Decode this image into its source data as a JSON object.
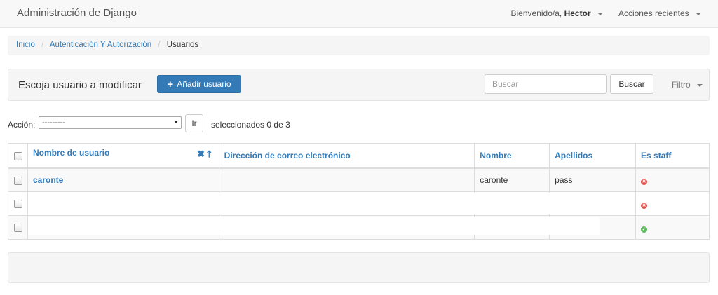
{
  "navbar": {
    "brand": "Administración de Django",
    "welcome_prefix": "Bienvenido/a,",
    "username": "Hector",
    "recent_actions": "Acciones recientes"
  },
  "breadcrumb": {
    "home": "Inicio",
    "section": "Autenticación Y Autorización",
    "current": "Usuarios"
  },
  "toolbar": {
    "title": "Escoja usuario a modificar",
    "add_label": "Añadir usuario",
    "search_placeholder": "Buscar",
    "search_button": "Buscar",
    "filter_label": "Filtro"
  },
  "actions": {
    "label": "Acción:",
    "selected_option": "---------",
    "go_label": "Ir",
    "selection_count": "seleccionados 0 de 3"
  },
  "table": {
    "columns": [
      "Nombre de usuario",
      "Dirección de correo electrónico",
      "Nombre",
      "Apellidos",
      "Es staff"
    ],
    "rows": [
      {
        "username": "caronte",
        "email": "",
        "first_name": "caronte",
        "last_name": "pass",
        "is_staff": "no"
      },
      {
        "username": "",
        "email": "",
        "first_name": "",
        "last_name": "",
        "is_staff": "no"
      },
      {
        "username": "",
        "email": "",
        "first_name": "",
        "last_name": "",
        "is_staff": "yes"
      }
    ]
  },
  "colors": {
    "primary": "#337ab7",
    "staff_no": "#d9534f",
    "staff_yes": "#5cb85c"
  }
}
